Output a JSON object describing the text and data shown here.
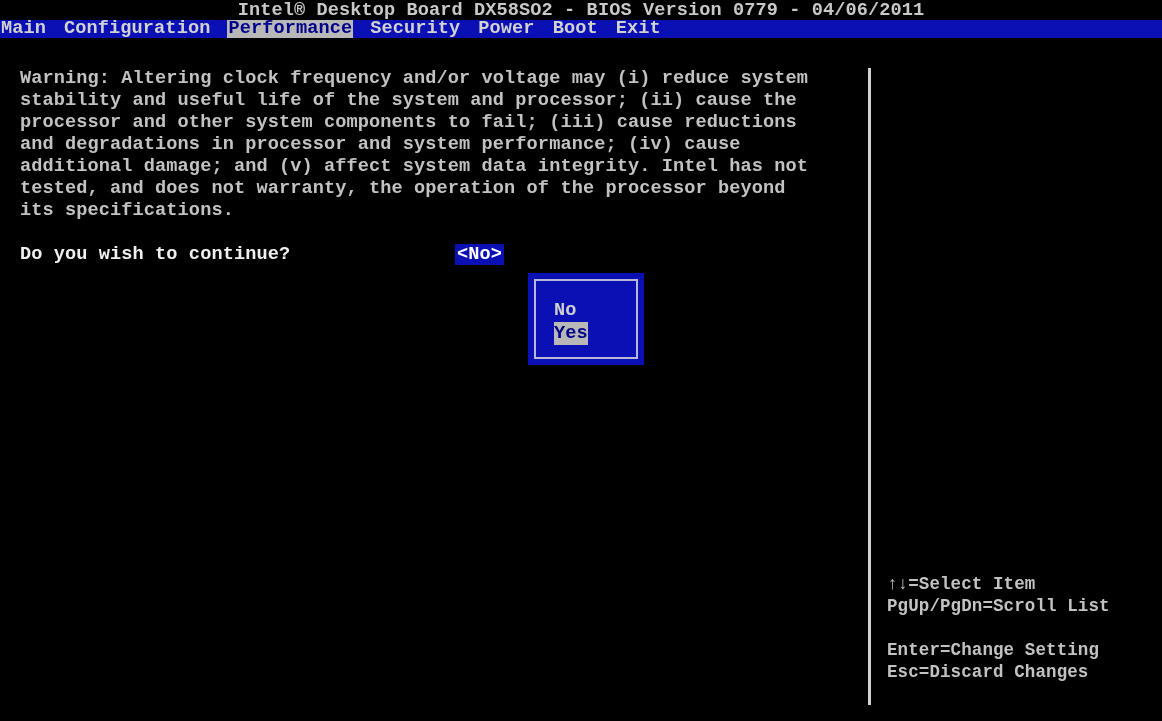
{
  "title": "Intel® Desktop Board DX58SO2 - BIOS Version 0779 - 04/06/2011",
  "menu": [
    {
      "label": "Main",
      "selected": false
    },
    {
      "label": "Configuration",
      "selected": false
    },
    {
      "label": "Performance",
      "selected": true
    },
    {
      "label": "Security",
      "selected": false
    },
    {
      "label": "Power",
      "selected": false
    },
    {
      "label": "Boot",
      "selected": false
    },
    {
      "label": "Exit",
      "selected": false
    }
  ],
  "warning": "Warning: Altering clock frequency and/or voltage may (i) reduce system\nstability and useful life of the system and processor; (ii) cause the\nprocessor and other system components to fail; (iii) cause reductions\nand degradations in processor and system performance; (iv) cause\nadditional damage; and (v) affect system data integrity. Intel has not\ntested, and does not warranty, the operation of the processor beyond\nits specifications.",
  "question": {
    "label": "Do you wish to continue?",
    "value": "<No>"
  },
  "popup": {
    "options": [
      {
        "label": "No",
        "selected": false
      },
      {
        "label": "Yes",
        "selected": true
      }
    ]
  },
  "help": [
    [
      "↑↓=Select Item",
      "PgUp/PgDn=Scroll List"
    ],
    [
      "Enter=Change Setting",
      "Esc=Discard Changes"
    ]
  ]
}
